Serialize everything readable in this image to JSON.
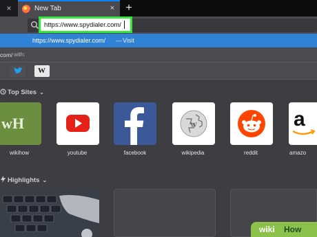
{
  "tabs": {
    "active_title": "New Tab",
    "close_glyph": "×",
    "new_tab_glyph": "+",
    "prev_tab_glyph": "×"
  },
  "urlbar": {
    "value": "https://www.spydialer.com/",
    "icon": "search-icon"
  },
  "suggestion": {
    "url": "https://www.spydialer.com/",
    "separator": "—",
    "action": "Visit"
  },
  "search_with": {
    "prefix": "com/",
    "label": "with:"
  },
  "engines": [
    {
      "name": "twitter-icon"
    },
    {
      "name": "wikipedia-icon",
      "glyph": "W"
    }
  ],
  "top_sites": {
    "heading": "Top Sites",
    "items": [
      {
        "label": "wikihow",
        "color": "#6b8f3e"
      },
      {
        "label": "youtube",
        "color": "#e62117"
      },
      {
        "label": "facebook",
        "color": "#3b5998"
      },
      {
        "label": "wikipedia",
        "color": "#ffffff"
      },
      {
        "label": "reddit",
        "color": "#ff4500"
      },
      {
        "label": "amazo",
        "color": "#ffffff"
      }
    ]
  },
  "highlights": {
    "heading": "Highlights"
  },
  "watermark": {
    "wiki": "wiki",
    "how": "How"
  },
  "colors": {
    "accent": "#0a84ff",
    "highlight_box": "#33e838",
    "suggestion_bg": "#2f82d6"
  }
}
